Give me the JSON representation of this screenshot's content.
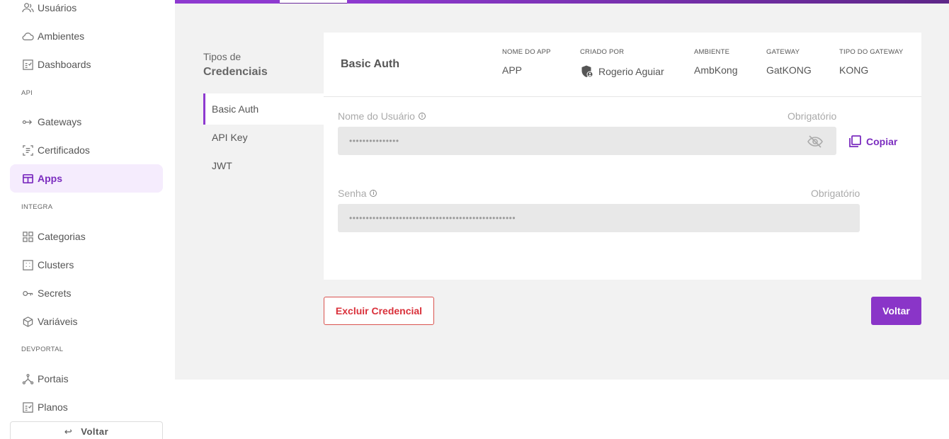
{
  "sidebar": {
    "items": [
      {
        "label": "Usuários",
        "icon": "users-icon"
      },
      {
        "label": "Ambientes",
        "icon": "cloud-icon"
      },
      {
        "label": "Dashboards",
        "icon": "dashboard-icon"
      },
      {
        "label": "Gateways",
        "icon": "gateway-icon"
      },
      {
        "label": "Certificados",
        "icon": "certificate-icon"
      },
      {
        "label": "Apps",
        "icon": "apps-icon"
      },
      {
        "label": "Categorias",
        "icon": "grid-icon"
      },
      {
        "label": "Clusters",
        "icon": "cluster-icon"
      },
      {
        "label": "Secrets",
        "icon": "key-icon"
      },
      {
        "label": "Variáveis",
        "icon": "cube-icon"
      },
      {
        "label": "Portais",
        "icon": "network-icon"
      },
      {
        "label": "Planos",
        "icon": "plan-icon"
      }
    ],
    "sections": {
      "api": "API",
      "integra": "INTEGRA",
      "devportal": "DEVPORTAL"
    },
    "back_label": "Voltar",
    "active_color": "#7b2cbf"
  },
  "types": {
    "title_line1": "Tipos de",
    "title_line2": "Credenciais",
    "tabs": [
      "Basic Auth",
      "API Key",
      "JWT"
    ]
  },
  "card": {
    "title": "Basic Auth",
    "meta": {
      "app_name_label": "NOME DO APP",
      "app_name": "APP",
      "created_by_label": "CRIADO POR",
      "created_by": "Rogerio Aguiar",
      "environment_label": "AMBIENTE",
      "environment": "AmbKong",
      "gateway_label": "GATEWAY",
      "gateway": "GatKONG",
      "gateway_type_label": "TIPO DO GATEWAY",
      "gateway_type": "KONG"
    },
    "username": {
      "label": "Nome do Usuário",
      "required": "Obrigatório",
      "value": "•••••••••••••••"
    },
    "password": {
      "label": "Senha",
      "required": "Obrigatório",
      "value": "••••••••••••••••••••••••••••••••••••••••••••••••••"
    },
    "copy_label": "Copiar"
  },
  "actions": {
    "delete_label": "Excluir Credencial",
    "back_label": "Voltar"
  }
}
